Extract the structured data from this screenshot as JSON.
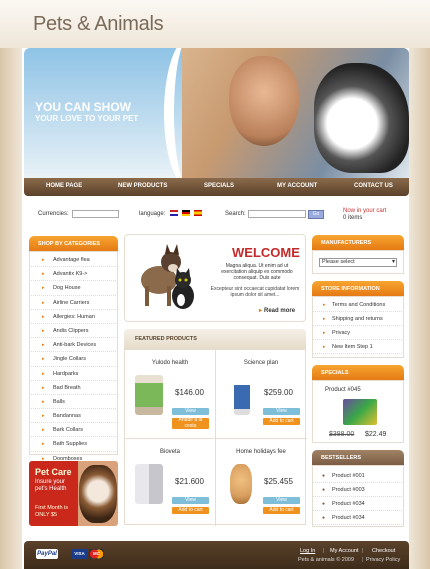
{
  "site": {
    "title": "Pets & Animals"
  },
  "banner": {
    "line1": "YOU CAN SHOW",
    "line2": "YOUR LOVE TO YOUR PET"
  },
  "nav": [
    "HOME PAGE",
    "NEW PRODUCTS",
    "SPECIALS",
    "MY ACCOUNT",
    "CONTACT US"
  ],
  "toolbar": {
    "currencies_label": "Currencies:",
    "language_label": "language:",
    "search_label": "Search:",
    "go_label": "Go",
    "cart_line1": "Now in your cart",
    "cart_line2": "0 items"
  },
  "categories": {
    "title": "SHOP BY CATEGORIES",
    "items": [
      "Advantage flea",
      "Advantix K9->",
      "Dog House",
      "Airline Carriers",
      "Allergies: Human",
      "Andis Clippers",
      "Anti-bark Devices",
      "Jingle Collars",
      "Hardparks",
      "Bad Breath",
      "Balls",
      "Bandannas",
      "Bark Collars",
      "Bath Supplies",
      "Doomboxes"
    ]
  },
  "promo": {
    "title": "Pet Care",
    "subtitle": "Insure your pet's Health",
    "offer": "First Month is ONLY $5"
  },
  "welcome": {
    "title": "WELCOME",
    "text1": "Magna aliqua. Ut enim ad ut exercitation aliquip ex commodo consequat. Duis aute",
    "text2": "Excepteur sint occaecat cupidatat lorem ipsum dolor sit amet...",
    "read_more": "Read more"
  },
  "featured": {
    "title": "FEATURED PRODUCTS",
    "view_label": "View",
    "add_label": "Add to cart",
    "add_label_first": "Anadir a la cesta",
    "products": [
      {
        "name": "Yulodo health",
        "price": "$146.00",
        "color": "#7ab85a"
      },
      {
        "name": "Science plan",
        "price": "$259.00",
        "color": "#3a6ab0"
      },
      {
        "name": "Bioveta",
        "price": "$21.600",
        "color": "#c6c6cc"
      },
      {
        "name": "Home holidays fee",
        "price": "$25.455",
        "color": "#d9a060"
      }
    ]
  },
  "manufacturers": {
    "title": "MANUFACTURERS",
    "select_value": "Please select"
  },
  "store_info": {
    "title": "STORE INFORMATION",
    "items": [
      "Terms and Conditions",
      "Shipping and returns",
      "Privacy",
      "New Item Step 1"
    ]
  },
  "specials": {
    "title": "SPECIALS",
    "product": "Product #045",
    "old_price": "$388.00",
    "new_price": "$22.49"
  },
  "bestsellers": {
    "title": "BESTSELLERS",
    "items": [
      "Product #001",
      "Product #003",
      "Product #034",
      "Product #034"
    ]
  },
  "footer": {
    "paypal": "PayPal",
    "visa": "VISA",
    "mastercard": "MC",
    "login": "Log In",
    "account": "My Account",
    "checkout": "Checkout",
    "copyright": "Pets & animals © 2009",
    "privacy": "Privacy Policy"
  },
  "colors": {
    "accent": "#e57a14",
    "brown": "#5a412a",
    "welcome": "#c3292a"
  }
}
